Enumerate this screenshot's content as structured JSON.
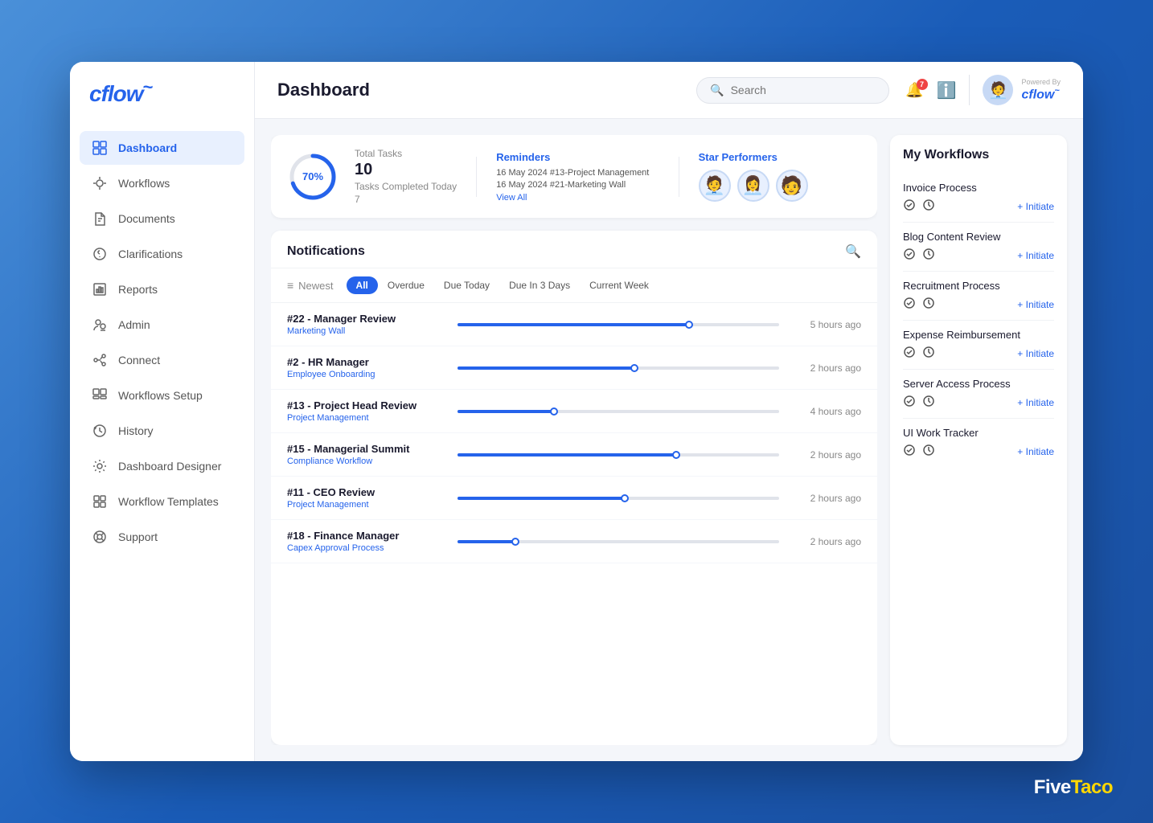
{
  "sidebar": {
    "logo": "cflow",
    "items": [
      {
        "id": "dashboard",
        "label": "Dashboard",
        "icon": "⊞",
        "active": true
      },
      {
        "id": "workflows",
        "label": "Workflows",
        "icon": "⚙"
      },
      {
        "id": "documents",
        "label": "Documents",
        "icon": "◻"
      },
      {
        "id": "clarifications",
        "label": "Clarifications",
        "icon": "◎"
      },
      {
        "id": "reports",
        "label": "Reports",
        "icon": "▦"
      },
      {
        "id": "admin",
        "label": "Admin",
        "icon": "👥"
      },
      {
        "id": "connect",
        "label": "Connect",
        "icon": "⚡"
      },
      {
        "id": "workflows-setup",
        "label": "Workflows Setup",
        "icon": "⊠"
      },
      {
        "id": "history",
        "label": "History",
        "icon": "↺"
      },
      {
        "id": "dashboard-designer",
        "label": "Dashboard Designer",
        "icon": "✿"
      },
      {
        "id": "workflow-templates",
        "label": "Workflow Templates",
        "icon": "⊡"
      },
      {
        "id": "support",
        "label": "Support",
        "icon": "◑"
      }
    ]
  },
  "header": {
    "title": "Dashboard",
    "search_placeholder": "Search",
    "notif_count": "7",
    "powered_label": "Powered By",
    "powered_logo": "cflow"
  },
  "stats": {
    "progress_pct": "70%",
    "total_tasks_label": "Total Tasks",
    "total_tasks_value": "10",
    "completed_label": "Tasks Completed Today",
    "completed_value": "7"
  },
  "reminders": {
    "title": "Reminders",
    "items": [
      "16 May 2024 #13-Project Management",
      "16 May 2024 #21-Marketing Wall"
    ],
    "view_all": "View All"
  },
  "star_performers": {
    "title": "Star Performers",
    "avatars": [
      "🧑‍💼",
      "👩‍💼",
      "🧑"
    ]
  },
  "notifications": {
    "title": "Notifications",
    "filter_label": "Newest",
    "filters": [
      "All",
      "Overdue",
      "Due Today",
      "Due In 3 Days",
      "Current Week"
    ],
    "active_filter": "All",
    "rows": [
      {
        "id": "#22 - Manager Review",
        "tag": "Marketing Wall",
        "time": "5 hours ago",
        "fill_pct": 72,
        "dot_pct": 72
      },
      {
        "id": "#2 - HR Manager",
        "tag": "Employee Onboarding",
        "time": "2 hours ago",
        "fill_pct": 55,
        "dot_pct": 55
      },
      {
        "id": "#13 - Project Head Review",
        "tag": "Project Management",
        "time": "4 hours ago",
        "fill_pct": 30,
        "dot_pct": 30
      },
      {
        "id": "#15 - Managerial Summit",
        "tag": "Compliance Workflow",
        "time": "2 hours ago",
        "fill_pct": 68,
        "dot_pct": 68
      },
      {
        "id": "#11 - CEO Review",
        "tag": "Project Management",
        "time": "2 hours ago",
        "fill_pct": 52,
        "dot_pct": 52
      },
      {
        "id": "#18 - Finance Manager",
        "tag": "Capex Approval Process",
        "time": "2 hours ago",
        "fill_pct": 18,
        "dot_pct": 18
      }
    ]
  },
  "my_workflows": {
    "title": "My Workflows",
    "items": [
      {
        "name": "Invoice Process"
      },
      {
        "name": "Blog Content Review"
      },
      {
        "name": "Recruitment Process"
      },
      {
        "name": "Expense Reimbursement"
      },
      {
        "name": "Server Access Process"
      },
      {
        "name": "UI Work Tracker"
      }
    ],
    "initiate_label": "+ Initiate"
  },
  "branding": {
    "text": "FiveTaco"
  }
}
